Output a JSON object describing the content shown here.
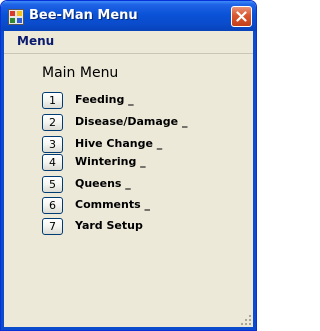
{
  "window": {
    "title": "Bee-Man Menu",
    "close_label": "×"
  },
  "menubar": {
    "items": [
      {
        "label": "Menu"
      }
    ]
  },
  "main": {
    "title": "Main Menu",
    "items": [
      {
        "number": "1",
        "label": "Feeding _"
      },
      {
        "number": "2",
        "label": "Disease/Damage _"
      },
      {
        "number": "3",
        "label": "Hive Change _"
      },
      {
        "number": "4",
        "label": "Wintering _"
      },
      {
        "number": "5",
        "label": "Queens _"
      },
      {
        "number": "6",
        "label": "Comments _"
      },
      {
        "number": "7",
        "label": "Yard Setup"
      }
    ]
  },
  "colors": {
    "titlebar": "#0a52d7",
    "window_face": "#ece9d8",
    "menu_text": "#0a1a6e",
    "close_button": "#d9562f"
  },
  "icons": {
    "app": "app-window-icon",
    "close": "close-icon",
    "grip": "resize-grip-icon"
  }
}
